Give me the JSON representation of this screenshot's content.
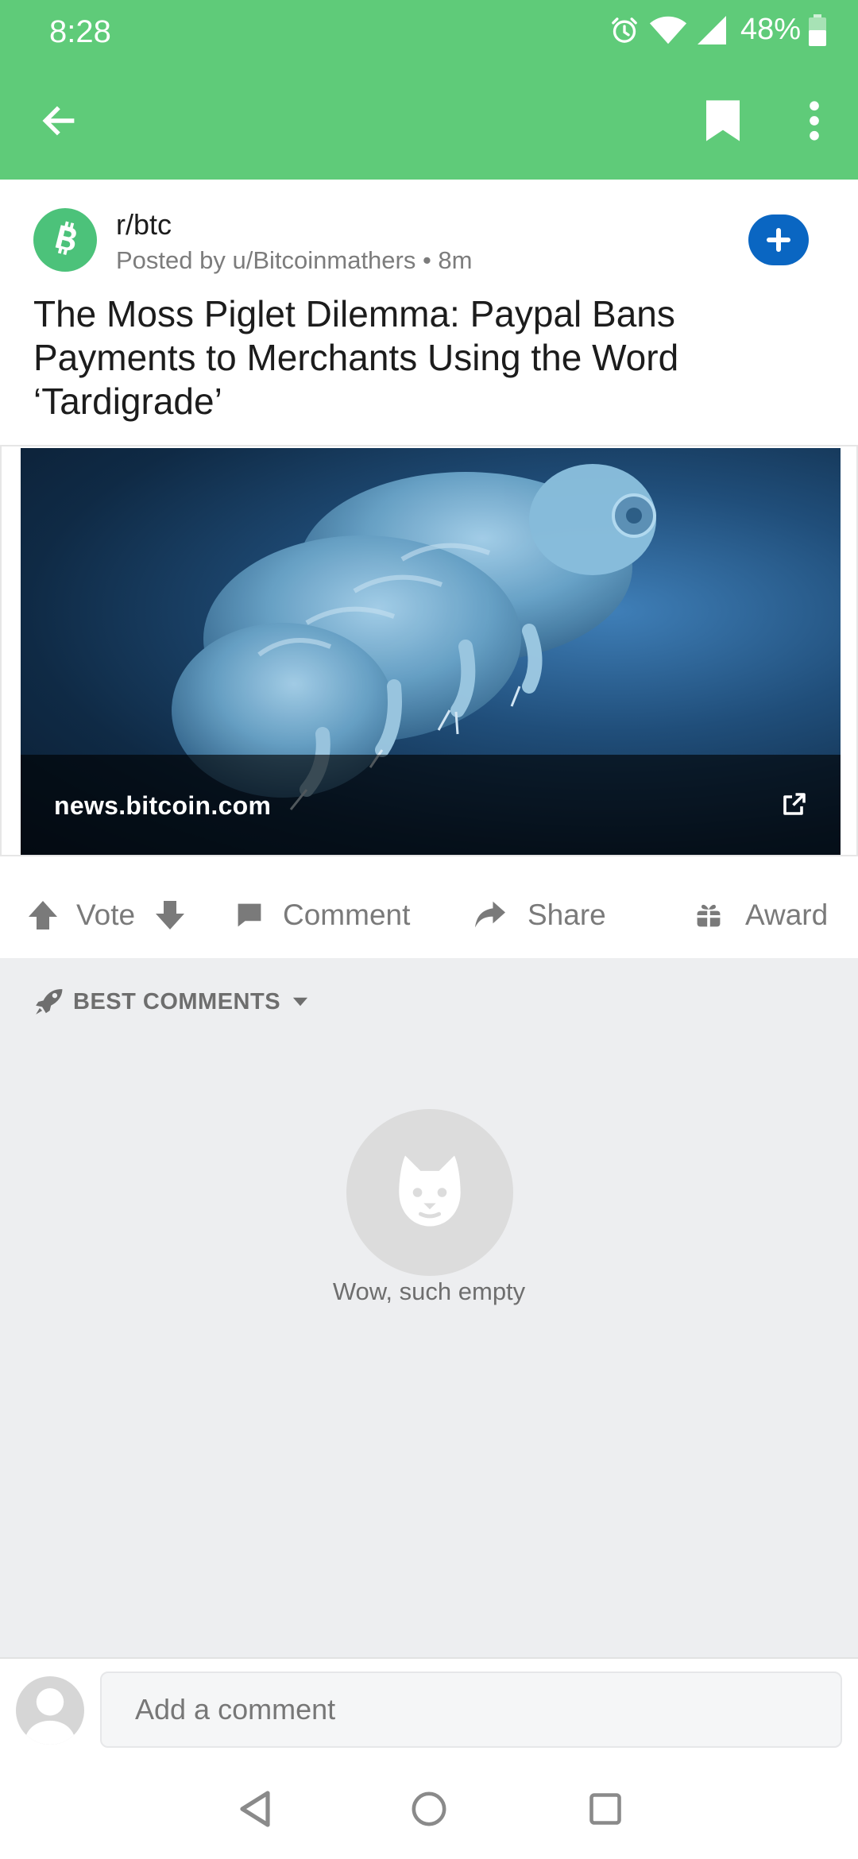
{
  "status_bar": {
    "time": "8:28",
    "battery_percent": "48%",
    "icons": [
      "alarm-icon",
      "wifi-icon",
      "signal-icon",
      "battery-icon"
    ]
  },
  "app_bar": {
    "icons": [
      "back-arrow-icon",
      "bookmark-icon",
      "more-vert-icon"
    ],
    "color": "#5FCB79"
  },
  "post": {
    "subreddit": "r/btc",
    "meta": "Posted by u/Bitcoinmathers • 8m",
    "title": "The Moss Piglet Dilemma: Paypal Bans Payments to Merchants Using the Word ‘Tardigrade’",
    "link_domain": "news.bitcoin.com"
  },
  "actions": {
    "vote": "Vote",
    "comment": "Comment",
    "share": "Share",
    "award": "Award"
  },
  "comments": {
    "sort_label": "BEST COMMENTS",
    "empty_text": "Wow, such empty"
  },
  "composer": {
    "placeholder": "Add a comment"
  },
  "nav": {
    "icons": [
      "nav-back-icon",
      "nav-home-icon",
      "nav-recents-icon"
    ]
  }
}
